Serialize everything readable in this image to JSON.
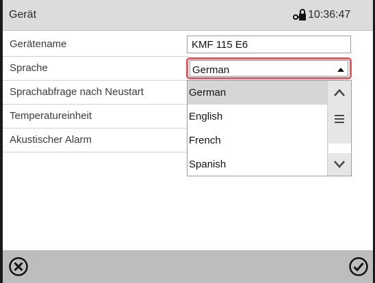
{
  "header": {
    "title": "Gerät",
    "lock_icon": "lock-key-icon",
    "time": "10:36:47"
  },
  "settings": {
    "rows": [
      {
        "label": "Gerätename"
      },
      {
        "label": "Sprache"
      },
      {
        "label": "Sprachabfrage nach Neustart"
      },
      {
        "label": "Temperatureinheit"
      },
      {
        "label": "Akustischer Alarm"
      }
    ],
    "device_name_value": "KMF 115 E6",
    "language_selected": "German",
    "highlight_color": "#e8585f"
  },
  "dropdown": {
    "options": [
      "German",
      "English",
      "French",
      "Spanish"
    ],
    "selected_index": 0,
    "scroll_up_icon": "chevron-up-icon",
    "scroll_down_icon": "chevron-down-icon",
    "scroll_thumb_icon": "menu-lines-icon"
  },
  "footer": {
    "cancel_icon": "close-circle-icon",
    "confirm_icon": "check-circle-icon"
  }
}
